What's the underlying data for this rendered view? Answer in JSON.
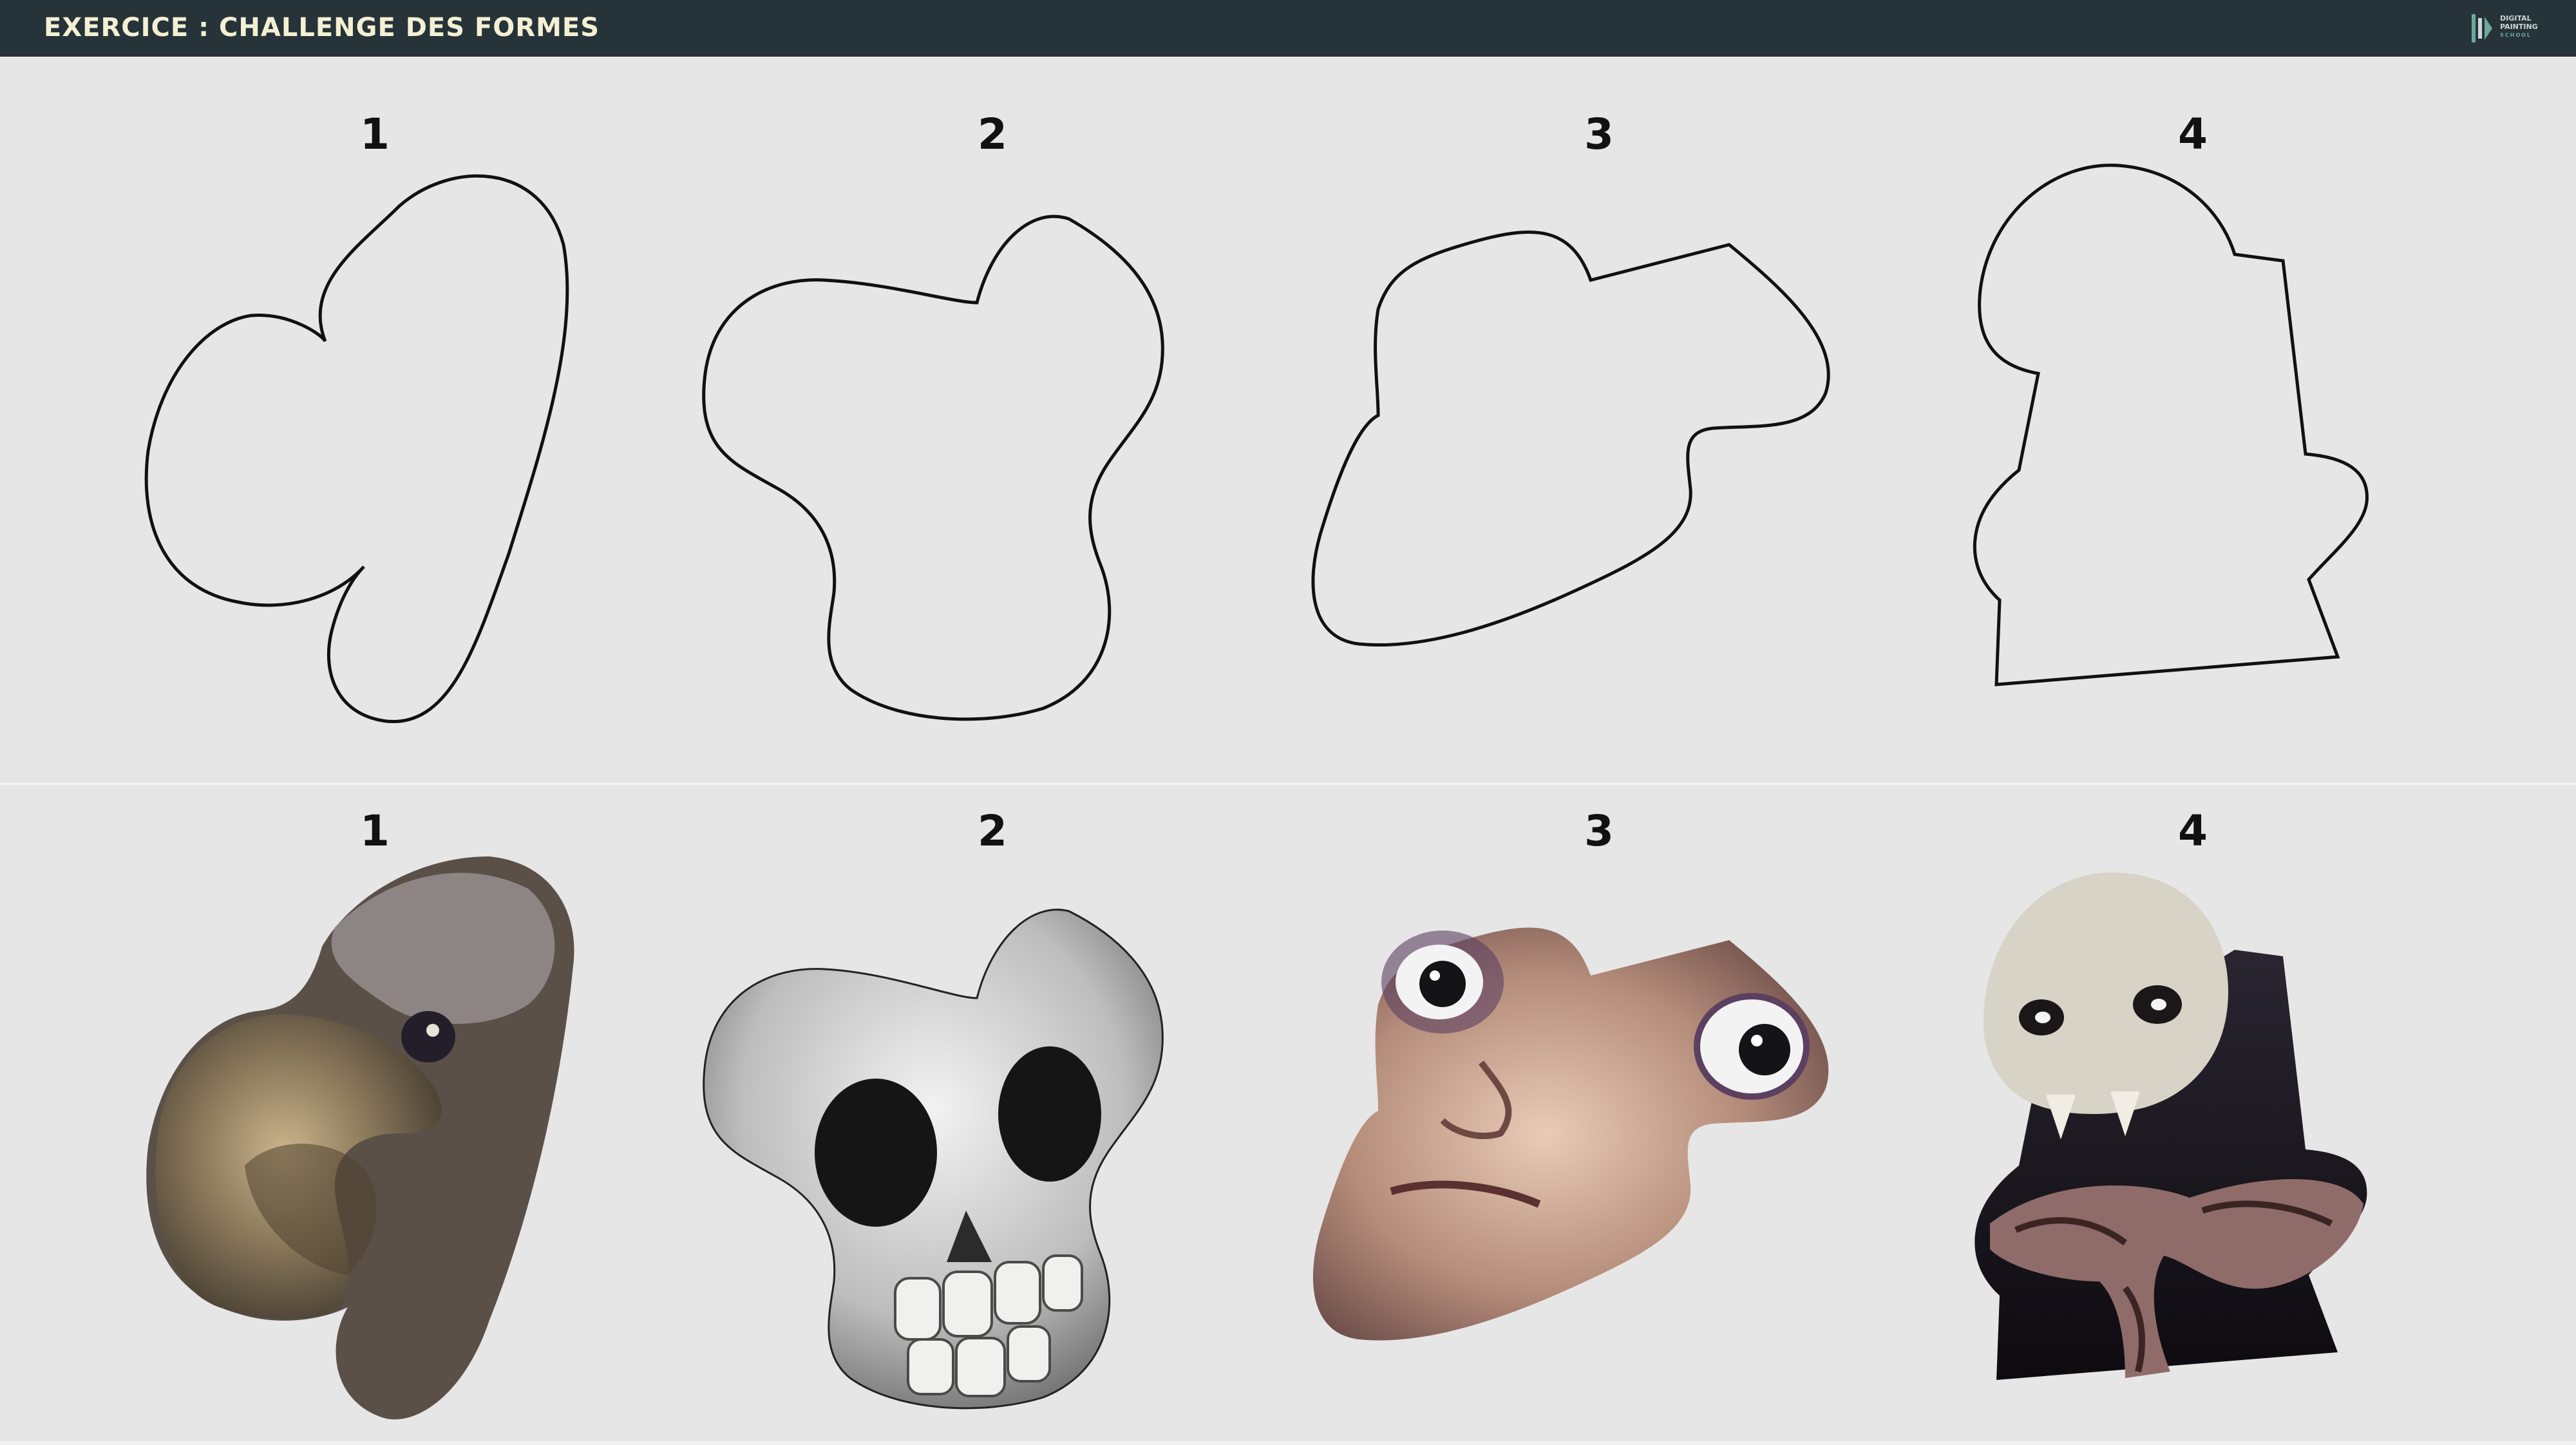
{
  "header": {
    "title": "EXERCICE : CHALLENGE DES FORMES",
    "logo": {
      "line1": "DIGITAL",
      "line2": "PAINTING",
      "line3": "SCHOOL"
    }
  },
  "outlines": [
    {
      "number": "1"
    },
    {
      "number": "2"
    },
    {
      "number": "3"
    },
    {
      "number": "4"
    }
  ],
  "paintings": [
    {
      "number": "1",
      "subject": "vulture-head"
    },
    {
      "number": "2",
      "subject": "skull"
    },
    {
      "number": "3",
      "subject": "face"
    },
    {
      "number": "4",
      "subject": "skull-creature"
    }
  ],
  "colors": {
    "header_bg": "#263338",
    "header_text": "#f4f0d4",
    "page_bg": "#e6e6e6"
  }
}
